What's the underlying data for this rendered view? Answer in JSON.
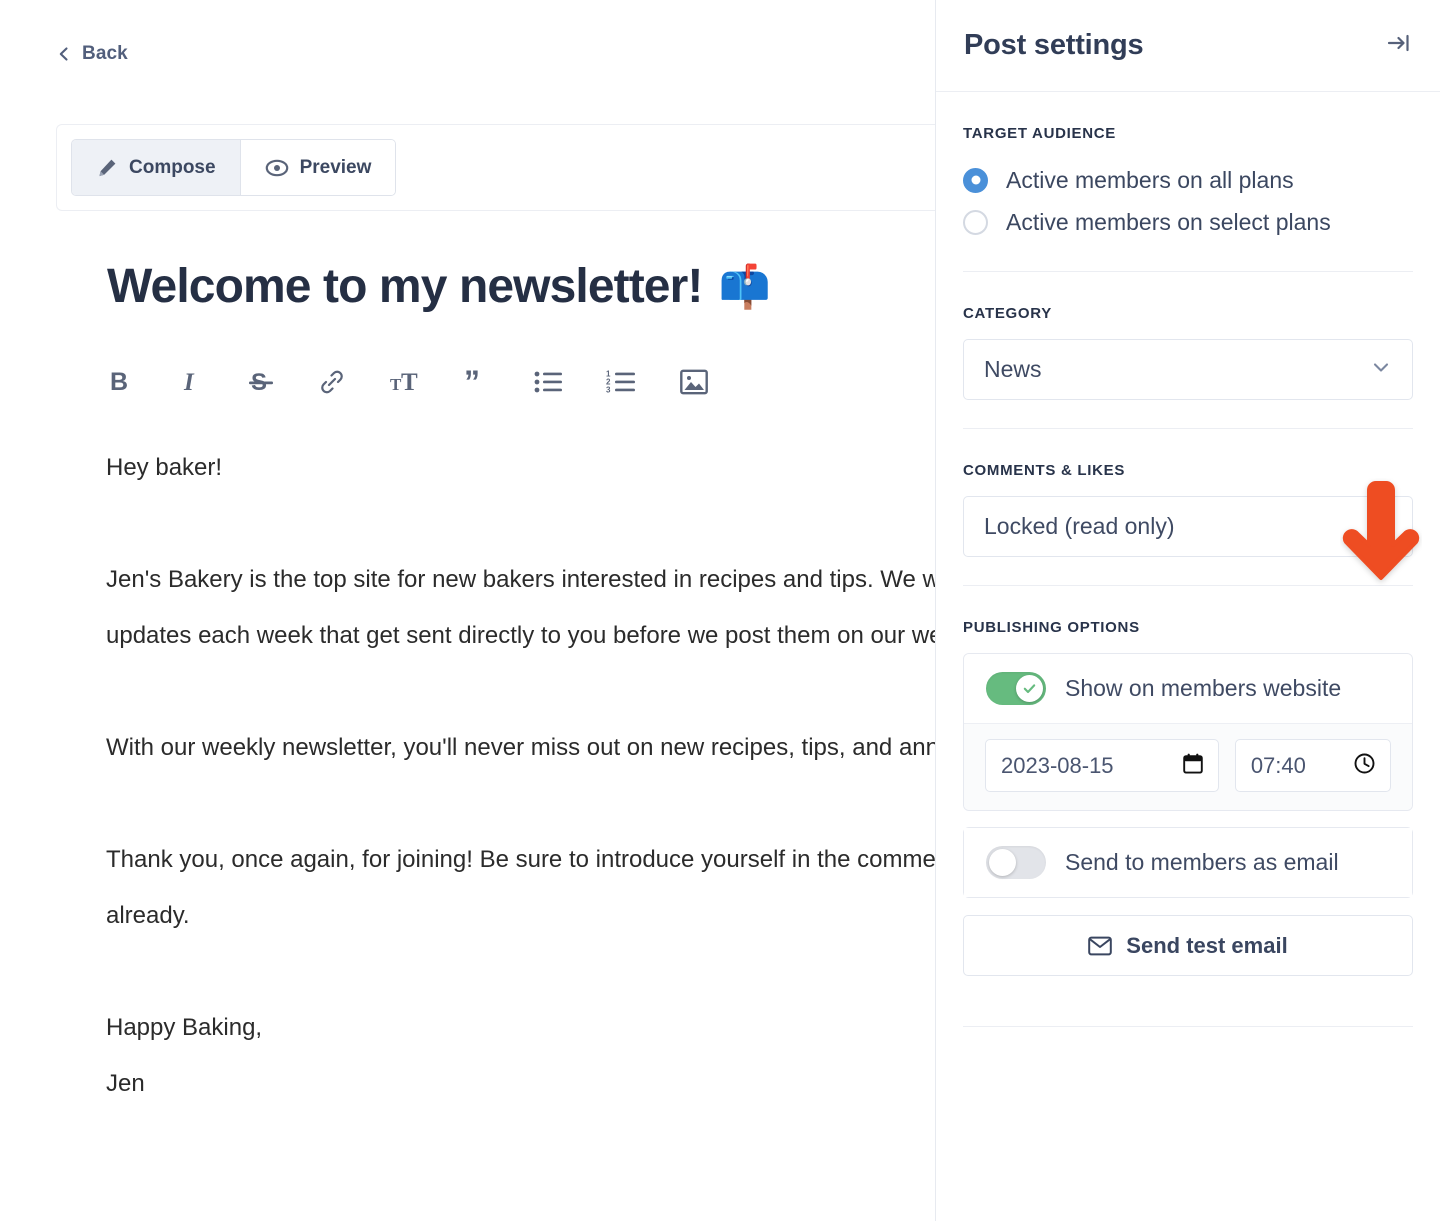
{
  "editor": {
    "back_label": "Back",
    "tabs": [
      {
        "label": "Compose",
        "icon": "pencil-icon",
        "active": true
      },
      {
        "label": "Preview",
        "icon": "eye-icon",
        "active": false
      }
    ],
    "doc_title": "Welcome to my newsletter!",
    "doc_title_emoji": "📫",
    "toolbar": [
      "bold-icon",
      "italic-icon",
      "strikethrough-icon",
      "link-icon",
      "text-size-icon",
      "quote-icon",
      "bullet-list-icon",
      "numbered-list-icon",
      "image-icon"
    ],
    "body": {
      "greeting": "Hey baker!",
      "paragraph_1": "Jen's Bakery is the top site for new bakers interested in recipes and tips. We will be delivering updates each week that get sent directly to you before we post them on our website.",
      "paragraph_2": "With our weekly newsletter, you'll never miss out on new recipes, tips, and announcements.",
      "paragraph_3": "Thank you, once again, for joining! Be sure to introduce yourself in the comments if you haven't already.",
      "signoff": "Happy Baking,",
      "signature": "Jen"
    }
  },
  "sidebar": {
    "title": "Post settings",
    "collapse_icon": "collapse-panel-icon",
    "target_audience": {
      "label": "Target audience",
      "options": [
        {
          "label": "Active members on all plans",
          "selected": true
        },
        {
          "label": "Active members on select plans",
          "selected": false
        }
      ]
    },
    "category": {
      "label": "Category",
      "value": "News"
    },
    "comments_likes": {
      "label": "Comments & likes",
      "value": "Locked (read only)"
    },
    "publishing_options": {
      "label": "Publishing options",
      "show_on_site": {
        "label": "Show on members website",
        "on": true
      },
      "publish_date": "2023-08-15",
      "publish_time": "07:40",
      "send_email": {
        "label": "Send to members as email",
        "on": false
      },
      "send_test_email_label": "Send test email"
    }
  },
  "annotation": {
    "arrow_color": "#ee4d24",
    "points_to": "Comments & likes dropdown"
  },
  "colors": {
    "accent_blue": "#4a90d9",
    "toggle_green": "#66bb7f",
    "arrow_orange": "#ee4d24",
    "text_dark": "#28334a",
    "border": "#e6e9f0"
  }
}
